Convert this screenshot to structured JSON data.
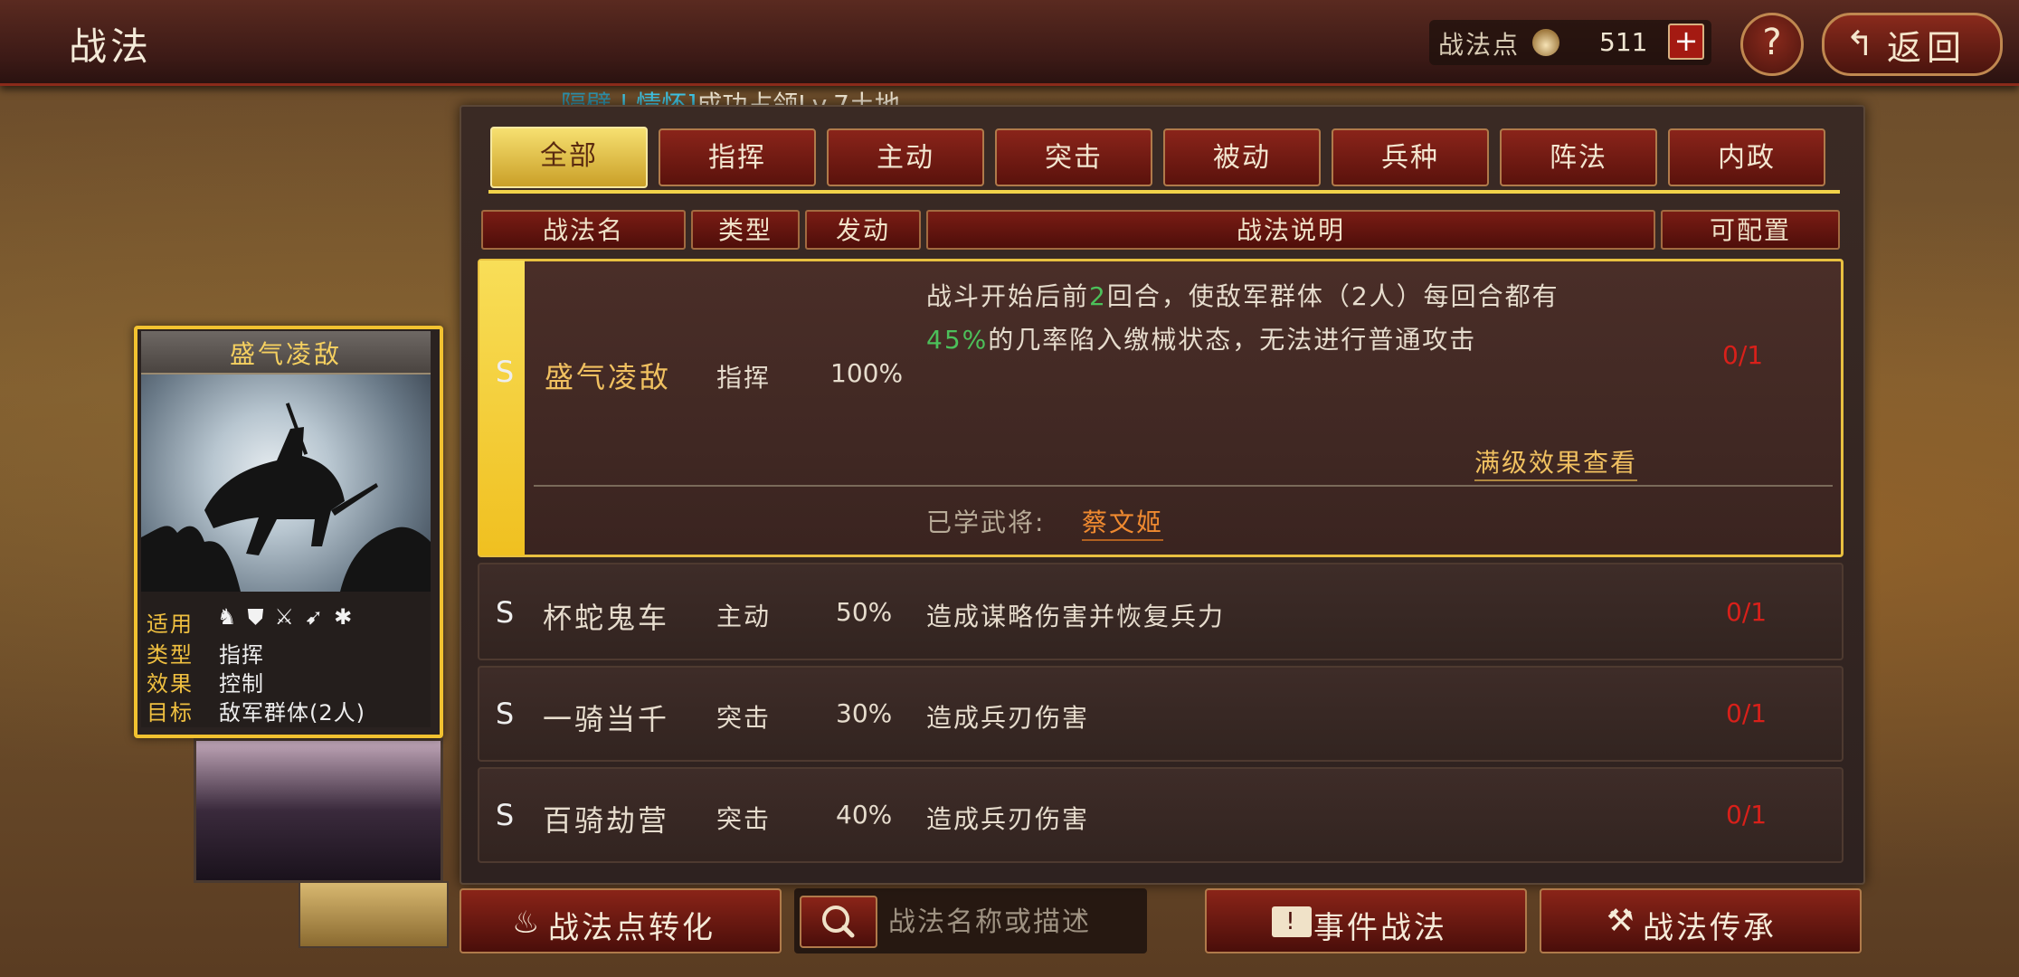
{
  "header": {
    "title": "战法",
    "points_label": "战法点",
    "points_value": "511",
    "plus_label": "+",
    "help_label": "?",
    "back_label": "返回",
    "back_icon": "↰"
  },
  "marquee": {
    "part1": "隔壁",
    "sep": " | ",
    "part2": "情怀",
    "bracket": "]",
    "text": "成功占领Lv.7土地"
  },
  "tabs": [
    "全部",
    "指挥",
    "主动",
    "突击",
    "被动",
    "兵种",
    "阵法",
    "内政"
  ],
  "columns": {
    "name": "战法名",
    "type": "类型",
    "trigger": "发动",
    "desc": "战法说明",
    "config": "可配置"
  },
  "tactics": [
    {
      "grade": "S",
      "name": "盛气凌敌",
      "type": "指挥",
      "rate": "100%",
      "desc_line1_a": "战斗开始后前",
      "desc_line1_num": "2",
      "desc_line1_b": "回合，使敌军群体（2人）每回合都有",
      "desc_line2_num": "45%",
      "desc_line2_b": "的几率陷入缴械状态，无法进行普通攻击",
      "config": "0/1",
      "full_effect_link": "满级效果查看",
      "learned_label": "已学武将:",
      "learned_general": "蔡文姬"
    },
    {
      "grade": "S",
      "name": "杯蛇鬼车",
      "type": "主动",
      "rate": "50%",
      "desc": "造成谋略伤害并恢复兵力",
      "config": "0/1"
    },
    {
      "grade": "S",
      "name": "一骑当千",
      "type": "突击",
      "rate": "30%",
      "desc": "造成兵刃伤害",
      "config": "0/1"
    },
    {
      "grade": "S",
      "name": "百骑劫营",
      "type": "突击",
      "rate": "40%",
      "desc": "造成兵刃伤害",
      "config": "0/1"
    }
  ],
  "card": {
    "title": "盛气凌敌",
    "applies_label": "适用",
    "type_label": "类型",
    "type_value": "指挥",
    "effect_label": "效果",
    "effect_value": "控制",
    "target_label": "目标",
    "target_value": "敌军群体(2人)",
    "unit_icons": [
      "cavalry-icon",
      "shield-icon",
      "bow-icon",
      "spear-icon",
      "chariot-icon"
    ]
  },
  "bottom": {
    "convert_label": "战法点转化",
    "search_placeholder": "战法名称或描述",
    "event_label": "事件战法",
    "inherit_label": "战法传承"
  },
  "colors": {
    "accent_gold": "#f2d24a",
    "tab_red": "#8a241a",
    "green_num": "#4cc05a",
    "config_red": "#d8201a",
    "link_gold": "#f0c060",
    "general_orange": "#f08a30"
  }
}
